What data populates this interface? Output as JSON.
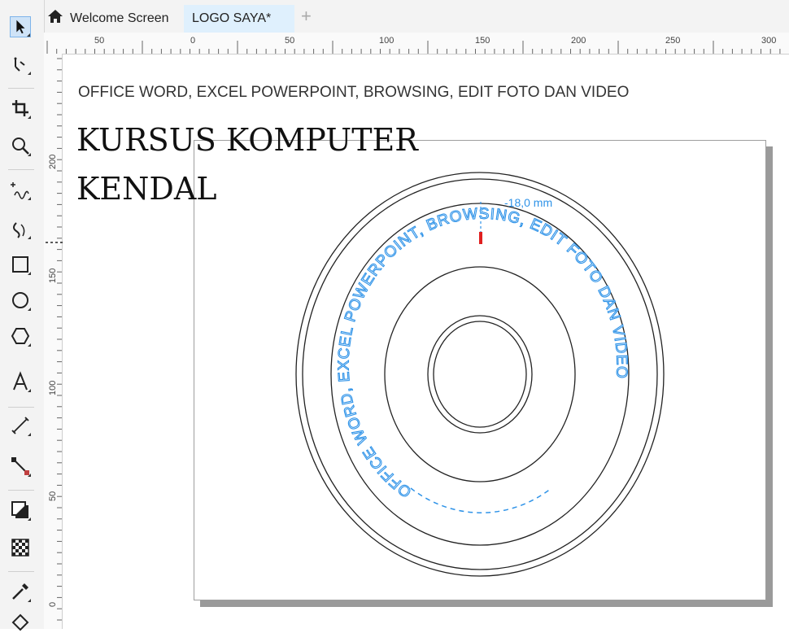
{
  "tabs": {
    "home_icon": "home-icon",
    "items": [
      {
        "label": "Welcome Screen"
      },
      {
        "label": "LOGO SAYA*"
      }
    ],
    "add_icon": "plus-icon"
  },
  "ruler": {
    "top_labels": [
      "50",
      "0",
      "50",
      "100",
      "150",
      "200",
      "250",
      "300"
    ],
    "left_labels": [
      "200",
      "150",
      "100",
      "50",
      "0"
    ]
  },
  "toolbox": {
    "tools": [
      "pick-tool-icon",
      "freehand-pick-icon",
      "crop-tool-icon",
      "zoom-tool-icon",
      "freehand-tool-icon",
      "artistic-media-icon",
      "rectangle-tool-icon",
      "ellipse-tool-icon",
      "polygon-tool-icon",
      "text-tool-icon",
      "parallel-dimension-icon",
      "connector-tool-icon",
      "drop-shadow-icon",
      "transparency-icon",
      "eyedropper-icon",
      "fill-tool-icon"
    ]
  },
  "document": {
    "headline": "OFFICE WORD, EXCEL POWERPOINT, BROWSING, EDIT FOTO DAN VIDEO",
    "brand_line1": "KURSUS KOMPUTER",
    "brand_line2": "KENDAL",
    "curved_text": "OFFICE WORD, EXCEL POWERPOINT, BROWSING, EDIT FOTO DAN VIDEO",
    "offset_label": "-18,0 mm",
    "accent_color": "#2f93e8"
  }
}
